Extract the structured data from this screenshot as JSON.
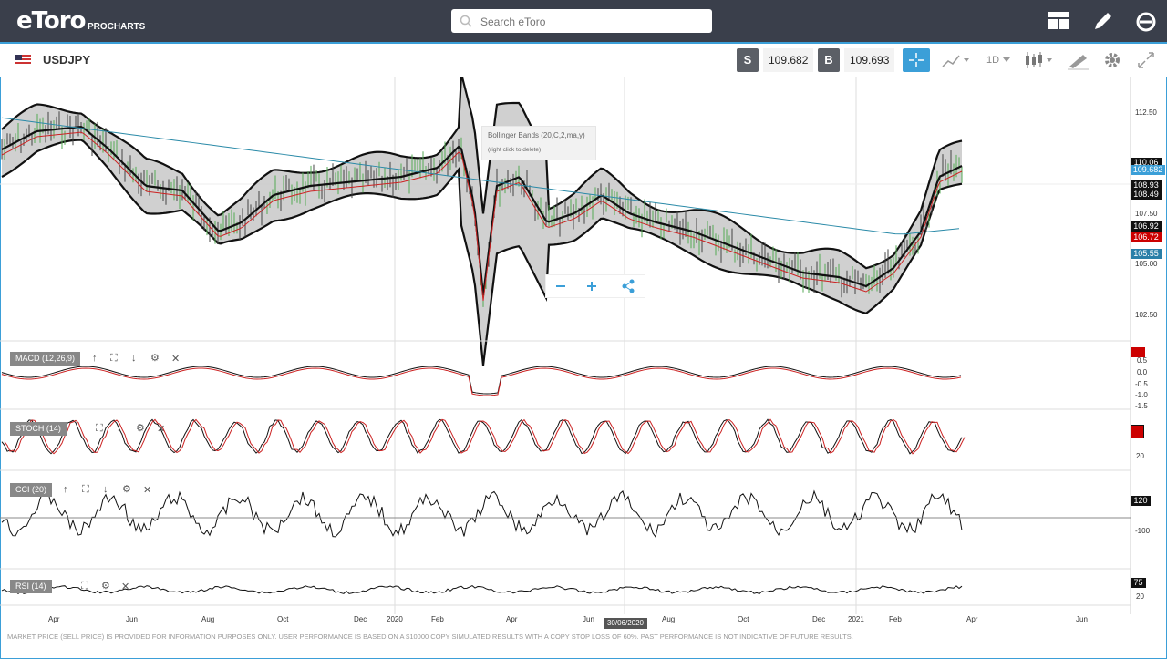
{
  "app": {
    "logo": "eToro",
    "sub": "PROCHARTS"
  },
  "search": {
    "placeholder": "Search eToro"
  },
  "toolbar": {
    "symbol": "USDJPY",
    "sell_label": "S",
    "sell_price": "109.682",
    "buy_label": "B",
    "buy_price": "109.693",
    "period": "1D"
  },
  "price_axis": [
    "112.50",
    "107.50",
    "105.00",
    "102.50"
  ],
  "price_tags": [
    {
      "text": "110.06",
      "color": "#111111"
    },
    {
      "text": "109.682",
      "color": "#3b9fd8"
    },
    {
      "text": "108.93",
      "color": "#111111"
    },
    {
      "text": "108.49",
      "color": "#111111"
    },
    {
      "text": "106.92",
      "color": "#111111"
    },
    {
      "text": "106.72",
      "color": "#cc0000"
    },
    {
      "text": "105.55",
      "color": "#2a7fa8"
    }
  ],
  "tooltip": {
    "title": "Bollinger Bands (20,C,2,ma,y)",
    "hint": "(right click to delete)"
  },
  "panels": {
    "macd": {
      "label": "MACD (12,26,9)",
      "axis": [
        "0.5",
        "0.0",
        "-0.5",
        "-1.0",
        "-1.5"
      ]
    },
    "stoch": {
      "label": "STOCH (14)",
      "axis": [
        "20"
      ]
    },
    "cci": {
      "label": "CCI (20)",
      "axis": [
        "120",
        "-100"
      ]
    },
    "rsi": {
      "label": "RSI (14)",
      "axis": [
        "75",
        "20"
      ]
    }
  },
  "dates": [
    "Apr",
    "Jun",
    "Aug",
    "Oct",
    "Dec",
    "2020",
    "Feb",
    "Apr",
    "Jun",
    "Aug",
    "Oct",
    "Dec",
    "2021",
    "Feb",
    "Apr",
    "Jun"
  ],
  "crosshair_date": "30/06/2020",
  "disclaimer": "MARKET PRICE (SELL PRICE) IS PROVIDED FOR INFORMATION PURPOSES ONLY. USER PERFORMANCE IS BASED ON A $10000 COPY SIMULATED RESULTS WITH A COPY STOP LOSS OF 60%. PAST PERFORMANCE IS NOT INDICATIVE OF FUTURE RESULTS.",
  "colors": {
    "topbar": "#3a3f4b",
    "accent": "#3b9fd8",
    "band_fill": "#c8c8c8",
    "ma_red": "#cc2222",
    "ma_blue": "#2a8aa8"
  },
  "icons": {
    "layout": "layout-icon",
    "edit": "pencil-icon",
    "user": "etoro-e-icon",
    "crosshair": "crosshair-icon",
    "chart_type": "chart-type-icon",
    "candles": "candlestick-icon",
    "draw": "draw-tool-icon",
    "settings": "gear-icon",
    "fullscreen": "fullscreen-icon"
  }
}
